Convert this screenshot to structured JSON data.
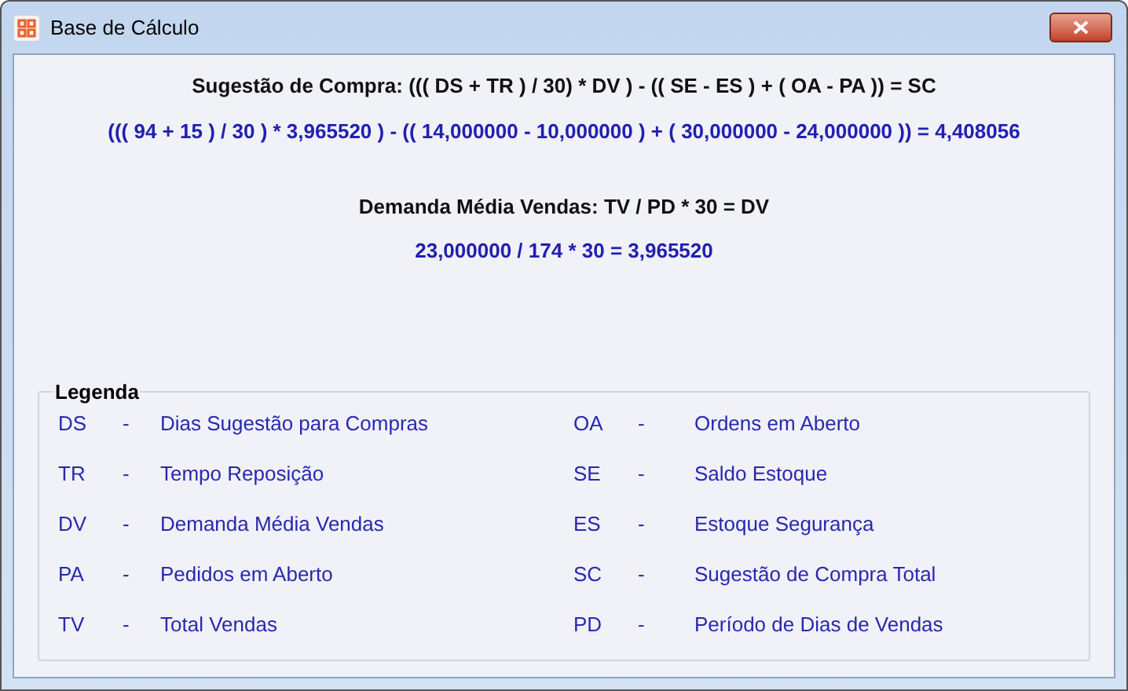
{
  "window": {
    "title": "Base de Cálculo"
  },
  "formulas": [
    {
      "heading": "Sugestão de Compra: ((( DS + TR ) / 30) * DV ) - (( SE - ES ) + ( OA - PA )) = SC",
      "result": "((( 94 + 15 ) / 30 ) * 3,965520 ) - (( 14,000000 - 10,000000 ) + ( 30,000000 - 24,000000 )) = 4,408056"
    },
    {
      "heading": "Demanda Média Vendas: TV / PD * 30 = DV",
      "result": "23,000000 / 174 * 30 = 3,965520"
    }
  ],
  "legend": {
    "title": "Legenda",
    "columns": [
      [
        {
          "code": "DS",
          "sep": "-",
          "label": "Dias Sugestão para Compras"
        },
        {
          "code": "TR",
          "sep": "-",
          "label": "Tempo Reposição"
        },
        {
          "code": "DV",
          "sep": "-",
          "label": "Demanda Média Vendas"
        },
        {
          "code": "PA",
          "sep": "-",
          "label": "Pedidos em Aberto"
        },
        {
          "code": "TV",
          "sep": "-",
          "label": "Total Vendas"
        }
      ],
      [
        {
          "code": "OA",
          "sep": "-",
          "label": "Ordens em Aberto"
        },
        {
          "code": "SE",
          "sep": "-",
          "label": "Saldo Estoque"
        },
        {
          "code": "ES",
          "sep": "-",
          "label": "Estoque Segurança"
        },
        {
          "code": "SC",
          "sep": "-",
          "label": "Sugestão de Compra Total"
        },
        {
          "code": "PD",
          "sep": "-",
          "label": "Período de Dias de Vendas"
        }
      ]
    ]
  }
}
